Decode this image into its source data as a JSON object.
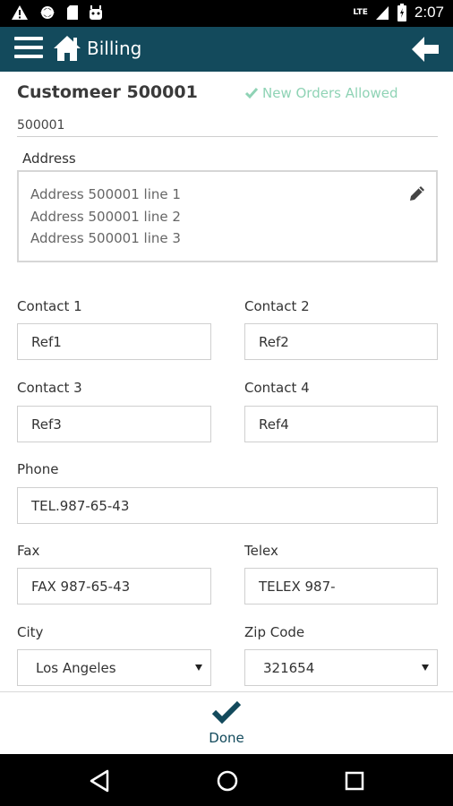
{
  "status_bar": {
    "time": "2:07",
    "network": "LTE",
    "icons": [
      "warning-icon",
      "sync-icon",
      "sd-card-icon",
      "android-icon",
      "signal-icon",
      "battery-icon"
    ]
  },
  "app_bar": {
    "title": "Billing",
    "icons": [
      "menu-icon",
      "home-icon",
      "back-arrow-icon"
    ],
    "color": "#134a5c"
  },
  "customer": {
    "name": "Customeer 500001",
    "status": "New Orders Allowed",
    "status_color": "#8fd3b5",
    "id": "500001"
  },
  "address": {
    "label": "Address",
    "lines": [
      "Address 500001 line 1",
      "Address 500001 line 2",
      "Address 500001 line 3"
    ]
  },
  "contacts": {
    "contact1": {
      "label": "Contact 1",
      "value": "Ref1"
    },
    "contact2": {
      "label": "Contact 2",
      "value": "Ref2"
    },
    "contact3": {
      "label": "Contact 3",
      "value": "Ref3"
    },
    "contact4": {
      "label": "Contact 4",
      "value": "Ref4"
    }
  },
  "phone": {
    "label": "Phone",
    "value": "TEL.987-65-43"
  },
  "fax": {
    "label": "Fax",
    "value": "FAX 987-65-43"
  },
  "telex": {
    "label": "Telex",
    "value": "TELEX 987-"
  },
  "city": {
    "label": "City",
    "value": "Los Angeles"
  },
  "zip": {
    "label": "Zip Code",
    "value": "321654"
  },
  "action": {
    "done_label": "Done"
  },
  "nav": {
    "icons": [
      "back-triangle-icon",
      "home-circle-icon",
      "recents-square-icon"
    ]
  }
}
